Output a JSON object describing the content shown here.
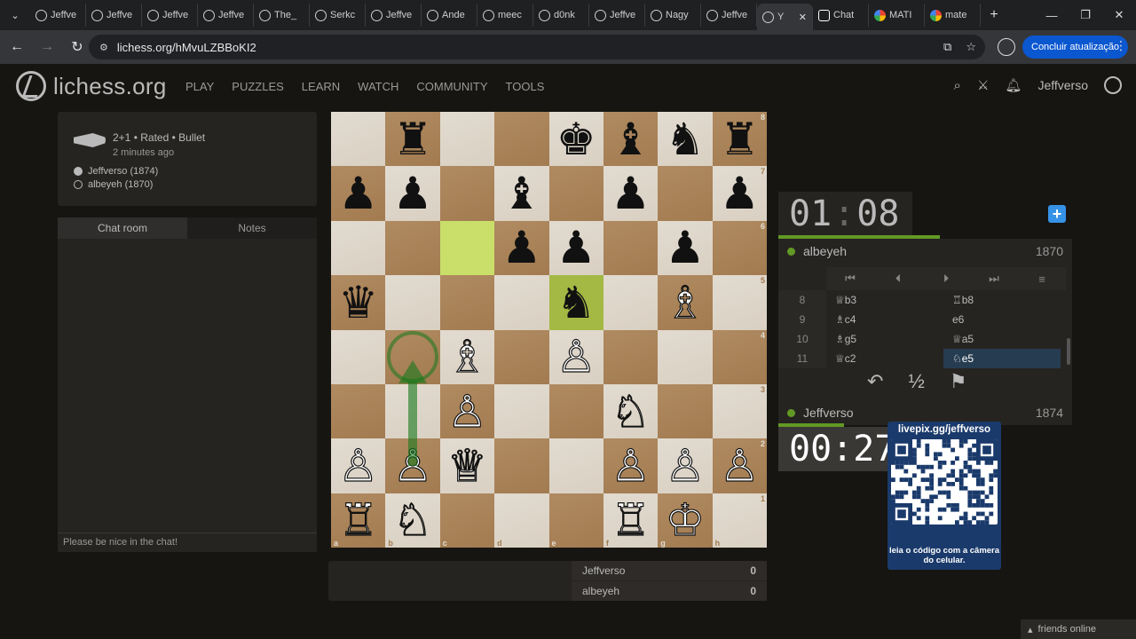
{
  "browser": {
    "tabs": [
      {
        "label": "Jeffve",
        "icon": "lichess"
      },
      {
        "label": "Jeffve",
        "icon": "lichess"
      },
      {
        "label": "Jeffve",
        "icon": "lichess"
      },
      {
        "label": "Jeffve",
        "icon": "lichess"
      },
      {
        "label": "The_",
        "icon": "lichess"
      },
      {
        "label": "Serkc",
        "icon": "lichess"
      },
      {
        "label": "Jeffve",
        "icon": "lichess"
      },
      {
        "label": "Ande",
        "icon": "lichess"
      },
      {
        "label": "meec",
        "icon": "lichess"
      },
      {
        "label": "d0nk",
        "icon": "lichess"
      },
      {
        "label": "Jeffve",
        "icon": "lichess"
      },
      {
        "label": "Nagy",
        "icon": "lichess"
      },
      {
        "label": "Jeffve",
        "icon": "lichess"
      },
      {
        "label": "Y",
        "icon": "lichess",
        "active": true
      },
      {
        "label": "Chat",
        "icon": "chat"
      },
      {
        "label": "MATI",
        "icon": "google"
      },
      {
        "label": "mate",
        "icon": "google"
      }
    ],
    "url": "lichess.org/hMvuLZBBoKI2",
    "update_label": "Concluir atualização"
  },
  "site": {
    "brand": "lichess.org",
    "nav": [
      "PLAY",
      "PUZZLES",
      "LEARN",
      "WATCH",
      "COMMUNITY",
      "TOOLS"
    ],
    "username": "Jeffverso"
  },
  "game": {
    "setup": "2+1 • Rated • Bullet",
    "ago": "2 minutes ago",
    "white": "Jeffverso (1874)",
    "black": "albeyeh (1870)"
  },
  "chat": {
    "tabs": [
      "Chat room",
      "Notes"
    ],
    "placeholder": "Please be nice in the chat!"
  },
  "board": {
    "ranks": [
      [
        " ",
        "♜",
        " ",
        " ",
        "♚",
        "♝",
        "♞",
        "♜"
      ],
      [
        "♟",
        "♟",
        " ",
        "♝",
        " ",
        "♟",
        " ",
        "♟"
      ],
      [
        " ",
        " ",
        " ",
        "♟",
        "♟",
        " ",
        "♟",
        " "
      ],
      [
        "♛",
        " ",
        " ",
        " ",
        "♞",
        " ",
        "♗",
        " "
      ],
      [
        " ",
        " ",
        "♗",
        " ",
        "♙",
        " ",
        " ",
        " "
      ],
      [
        " ",
        " ",
        "♙",
        " ",
        " ",
        "♘",
        " ",
        " "
      ],
      [
        "♙",
        "♙",
        "♕",
        " ",
        " ",
        "♙",
        "♙",
        "♙"
      ],
      [
        "♖",
        "♘",
        " ",
        " ",
        " ",
        "♖",
        "♔",
        " "
      ]
    ],
    "rank_labels": [
      "8",
      "7",
      "6",
      "5",
      "4",
      "3",
      "2",
      "1"
    ],
    "file_labels": [
      "a",
      "b",
      "c",
      "d",
      "e",
      "f",
      "g",
      "h"
    ],
    "last_move_squares": [
      "c6",
      "e5"
    ]
  },
  "crosstable": {
    "rows": [
      {
        "name": "Jeffverso",
        "score": "0"
      },
      {
        "name": "albeyeh",
        "score": "0"
      }
    ]
  },
  "clocks": {
    "top": {
      "min": "01",
      "sec": "08"
    },
    "bottom": {
      "min": "00",
      "sec": "27"
    }
  },
  "players": {
    "top": {
      "name": "albeyeh",
      "rating": "1870"
    },
    "bottom": {
      "name": "Jeffverso",
      "rating": "1874"
    }
  },
  "moves": [
    {
      "num": "8",
      "white": "♕b3",
      "black": "♖b8"
    },
    {
      "num": "9",
      "white": "♗c4",
      "black": "e6"
    },
    {
      "num": "10",
      "white": "♗g5",
      "black": "♕a5"
    },
    {
      "num": "11",
      "white": "♕c2",
      "black": "♘e5",
      "current": "black"
    }
  ],
  "controls": {
    "first": "⏮",
    "prev": "⏴",
    "next": "⏵",
    "last": "⏭",
    "menu": "≡",
    "takeback": "↶",
    "draw": "½",
    "resign": "⚑"
  },
  "qr": {
    "title": "livepix.gg/jeffverso",
    "caption": "leia o código com a câmera do celular."
  },
  "friends": "friends online",
  "colors": {
    "accent_green": "#629924",
    "accent_blue": "#3692e7",
    "highlight": "#c9df6a"
  }
}
